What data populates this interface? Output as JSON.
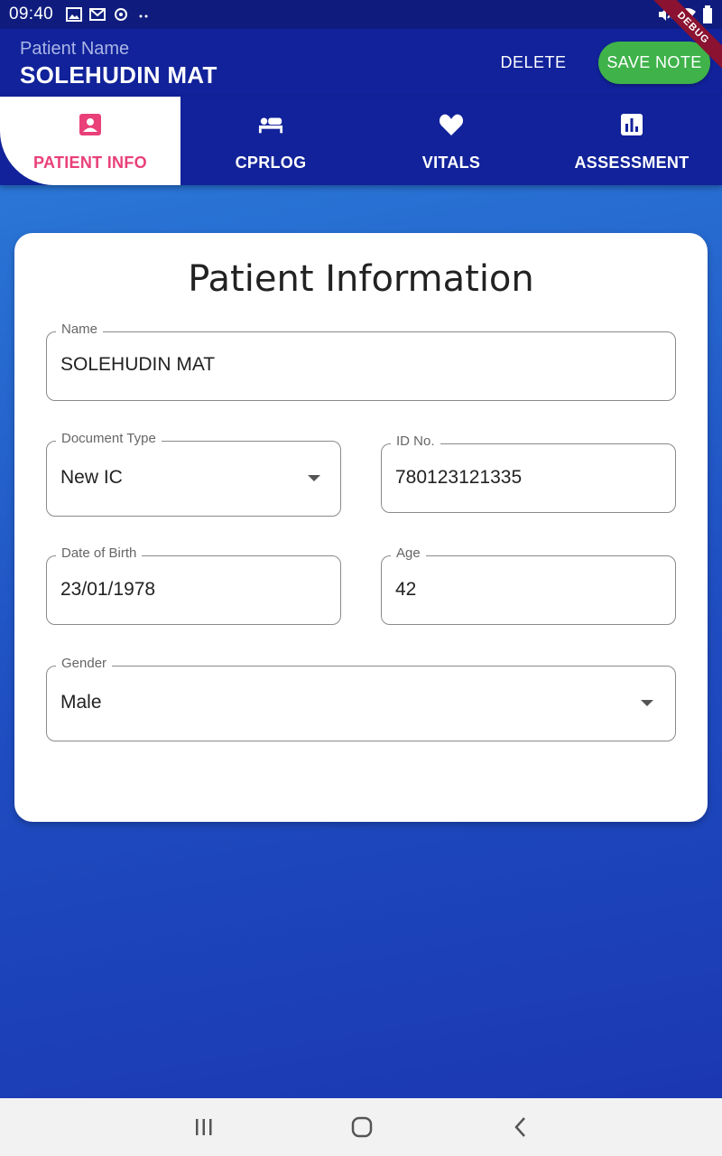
{
  "status_bar": {
    "time": "09:40",
    "icons_left": [
      "image-icon",
      "mail-icon",
      "sync-icon",
      "more-dots-icon"
    ],
    "icons_right": [
      "mute-icon",
      "wifi-icon",
      "battery-icon"
    ]
  },
  "app_bar": {
    "patient_label": "Patient Name",
    "patient_name": "SOLEHUDIN MAT",
    "delete_label": "DELETE",
    "save_label": "SAVE NOTE",
    "debug_label": "DEBUG"
  },
  "tabs": [
    {
      "label": "PATIENT INFO",
      "icon": "contact-card-icon",
      "active": true
    },
    {
      "label": "CPRLOG",
      "icon": "bed-icon",
      "active": false
    },
    {
      "label": "VITALS",
      "icon": "heart-icon",
      "active": false
    },
    {
      "label": "ASSESSMENT",
      "icon": "bar-chart-icon",
      "active": false
    }
  ],
  "form": {
    "title": "Patient Information",
    "name": {
      "label": "Name",
      "value": "SOLEHUDIN MAT"
    },
    "document_type": {
      "label": "Document Type",
      "value": "New IC"
    },
    "id_no": {
      "label": "ID No.",
      "value": "780123121335"
    },
    "dob": {
      "label": "Date of Birth",
      "value": "23/01/1978"
    },
    "age": {
      "label": "Age",
      "value": "42"
    },
    "gender": {
      "label": "Gender",
      "value": "Male"
    }
  },
  "nav_bar": {
    "icons": [
      "recent-apps-icon",
      "home-icon",
      "back-icon"
    ]
  },
  "colors": {
    "app_bar": "#11229a",
    "accent_pink": "#e9407a",
    "save_green": "#3fb24a"
  }
}
